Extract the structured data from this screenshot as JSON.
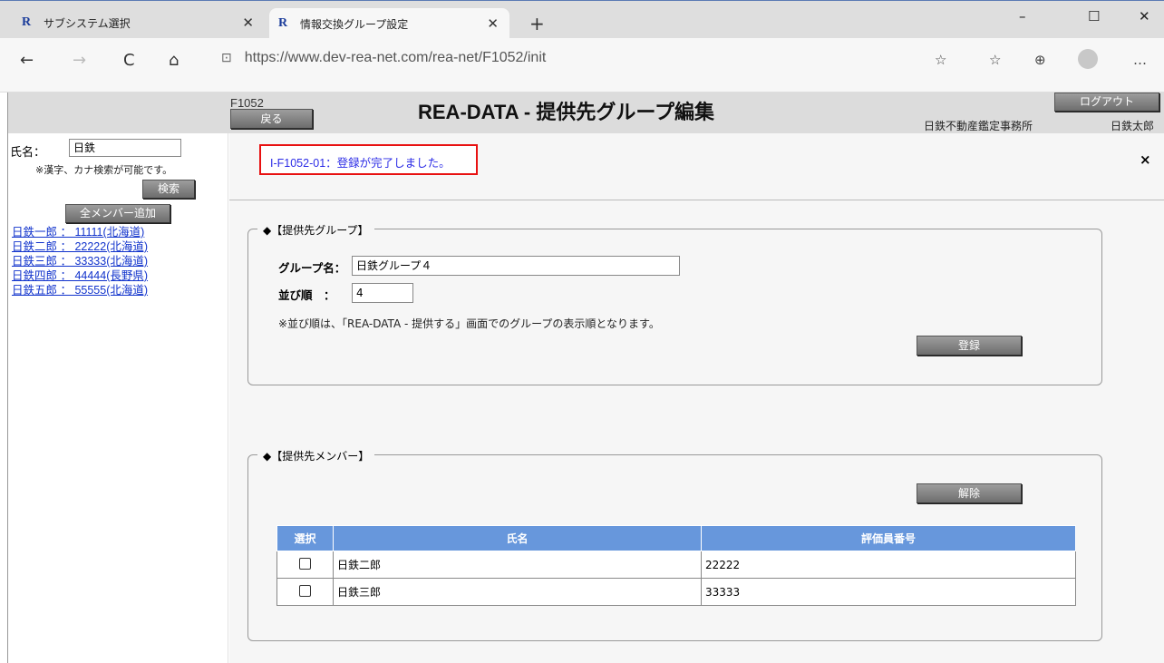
{
  "browser": {
    "tabs": [
      {
        "label": "サブシステム選択",
        "favicon": "R"
      },
      {
        "label": "情報交換グループ設定",
        "favicon": "R"
      }
    ],
    "url": "https://www.dev-rea-net.com/rea-net/F1052/init",
    "icons": {
      "back": "←",
      "forward": "→",
      "reload": "C",
      "home": "⌂",
      "close": "✕",
      "new_tab": "+",
      "minimize": "–",
      "maximize": "☐",
      "win_close": "✕",
      "lock": "⊡",
      "favorite": "☆",
      "favorites_bar": "☆",
      "collections": "⊕",
      "more": "…"
    }
  },
  "header": {
    "screen_code": "F1052",
    "back_label": "戻る",
    "title": "REA-DATA - 提供先グループ編集",
    "logout_label": "ログアウト",
    "company": "日鉄不動産鑑定事務所",
    "user": "日鉄太郎"
  },
  "sidebar": {
    "name_label": "氏名：",
    "name_value": "日鉄",
    "note": "※漢字、カナ検索が可能です。",
    "search_label": "検索",
    "add_all_label": "全メンバー追加",
    "members": [
      "日鉄一郎 ： 11111(北海道)",
      "日鉄二郎 ： 22222(北海道)",
      "日鉄三郎 ： 33333(北海道)",
      "日鉄四郎 ： 44444(長野県)",
      "日鉄五郎 ： 55555(北海道)"
    ]
  },
  "message": {
    "text": "I-F1052-01：登録が完了しました。",
    "close": "×"
  },
  "group": {
    "legend": "◆【提供先グループ】",
    "name_label": "グループ名：",
    "name_value": "日鉄グループ４",
    "order_label": "並び順　：",
    "order_value": "4",
    "note": "※並び順は、「REA-DATA - 提供する」画面でのグループの表示順となります。",
    "register_label": "登録"
  },
  "members": {
    "legend": "◆【提供先メンバー】",
    "release_label": "解除",
    "columns": [
      "選択",
      "氏名",
      "評価員番号"
    ],
    "rows": [
      {
        "name": "日鉄二郎",
        "number": "22222"
      },
      {
        "name": "日鉄三郎",
        "number": "33333"
      }
    ]
  }
}
